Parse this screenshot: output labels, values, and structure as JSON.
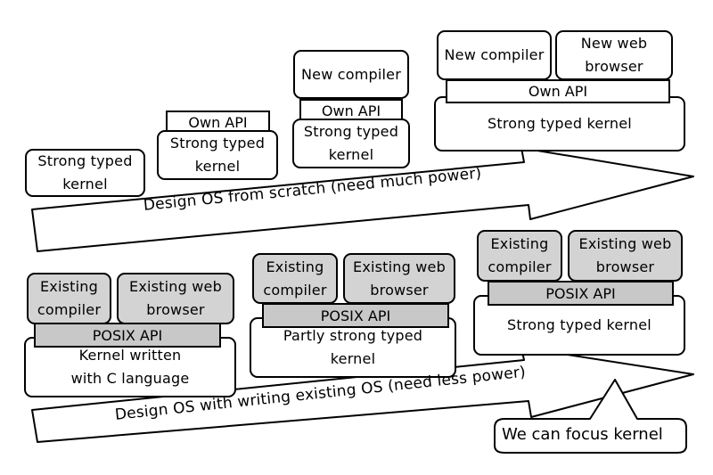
{
  "top": {
    "stage1": {
      "kernel": "Strong typed\nkernel"
    },
    "stage2": {
      "api": "Own API",
      "kernel": "Strong typed\nkernel"
    },
    "stage3": {
      "compiler": "New compiler",
      "api": "Own API",
      "kernel": "Strong typed\nkernel"
    },
    "stage4": {
      "compiler": "New compiler",
      "browser": "New web\nbrowser",
      "api": "Own API",
      "kernel": "Strong typed kernel"
    },
    "arrow_label": "Design OS from scratch (need much power)"
  },
  "bottom": {
    "stage1": {
      "compiler": "Existing\ncompiler",
      "browser": "Existing web\nbrowser",
      "api": "POSIX API",
      "kernel": "Kernel written\nwith C language"
    },
    "stage2": {
      "compiler": "Existing\ncompiler",
      "browser": "Existing web\nbrowser",
      "api": "POSIX API",
      "kernel": "Partly strong typed\nkernel"
    },
    "stage3": {
      "compiler": "Existing\ncompiler",
      "browser": "Existing web\nbrowser",
      "api": "POSIX API",
      "kernel": "Strong typed kernel"
    },
    "arrow_label": "Design OS with writing existing OS (need less power)"
  },
  "callout": {
    "text": "We can focus kernel"
  }
}
